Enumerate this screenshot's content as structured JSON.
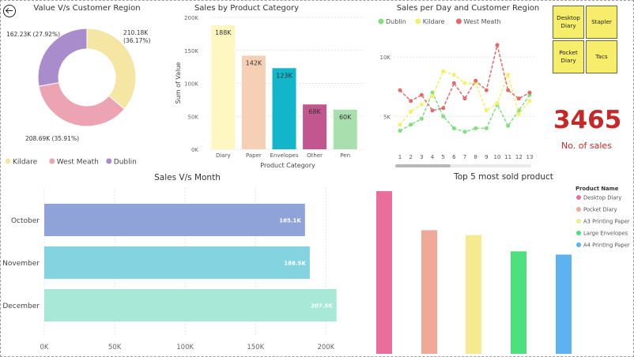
{
  "kpi": {
    "value": "3465",
    "label": "No. of sales"
  },
  "slicer": {
    "items": [
      "Desktop Diary",
      "Stapler",
      "Pocket Diary",
      "Tacs"
    ]
  },
  "colors": {
    "kpi": "#c62828",
    "slicer_bg": "#f6ee6a"
  },
  "icons": {
    "back": "back-arrow-icon"
  },
  "chart_data": [
    {
      "type": "pie",
      "title": "Value V/s Customer Region",
      "slices": [
        {
          "name": "Kildare",
          "value": 210.18,
          "label": "210.18K (36.17%)",
          "color": "#f5e6a3"
        },
        {
          "name": "West Meath",
          "value": 208.69,
          "label": "208.69K (35.91%)",
          "color": "#eca4b4"
        },
        {
          "name": "Dublin",
          "value": 162.23,
          "label": "162.23K (27.92%)",
          "color": "#a98ccb"
        }
      ],
      "legend": [
        "Kildare",
        "West Meath",
        "Dublin"
      ],
      "legend_position": "bottom-left"
    },
    {
      "type": "bar",
      "title": "Sales by Product Category",
      "categories": [
        "Diary",
        "Paper",
        "Envelopes",
        "Other",
        "Pen"
      ],
      "values": [
        188,
        142,
        123,
        68,
        60
      ],
      "data_labels": [
        "188K",
        "142K",
        "123K",
        "68K",
        "60K"
      ],
      "colors": [
        "#fff7c2",
        "#f5d0b4",
        "#12b5c9",
        "#c2568f",
        "#a9dfae"
      ],
      "xlabel": "Product Category",
      "ylabel": "Sum of Value",
      "yticks": [
        "0K",
        "50K",
        "100K",
        "150K",
        "200K"
      ],
      "ylim": [
        0,
        200
      ]
    },
    {
      "type": "line",
      "title": "Sales per Day and Customer Region",
      "x": [
        1,
        2,
        3,
        4,
        5,
        6,
        7,
        8,
        9,
        10,
        11,
        12,
        13
      ],
      "series": [
        {
          "name": "Dublin",
          "color": "#7ee07e",
          "values": [
            3.8,
            4.3,
            4.8,
            7.0,
            5.0,
            4.0,
            3.7,
            4.0,
            4.0,
            6.0,
            4.2,
            5.5,
            6.8
          ]
        },
        {
          "name": "Kildare",
          "color": "#f4f06a",
          "values": [
            4.3,
            5.4,
            6.0,
            6.7,
            8.8,
            8.5,
            7.8,
            7.8,
            5.5,
            6.1,
            8.5,
            5.2,
            6.3
          ]
        },
        {
          "name": "West Meath",
          "color": "#e46a6a",
          "values": [
            7.2,
            6.3,
            6.8,
            5.5,
            5.7,
            7.8,
            6.5,
            8.0,
            7.2,
            11.0,
            7.2,
            6.5,
            7.0
          ]
        }
      ],
      "yticks": [
        "5K",
        "10K"
      ],
      "ylim": [
        2.5,
        12
      ],
      "legend_position": "top-left"
    },
    {
      "type": "bar",
      "orientation": "horizontal",
      "title": "Sales V/s Month",
      "categories": [
        "October",
        "November",
        "December"
      ],
      "values": [
        185.1,
        188.5,
        207.5
      ],
      "data_labels": [
        "185.1K",
        "188.5K",
        "207.5K"
      ],
      "colors": [
        "#8fa3d9",
        "#84d3e0",
        "#a8e8d6"
      ],
      "xticks": [
        "0K",
        "50K",
        "100K",
        "150K",
        "200K"
      ],
      "xlim": [
        0,
        220
      ]
    },
    {
      "type": "bar",
      "title": "Top 5 most sold product",
      "categories": [
        "Desktop Diary",
        "Pocket Diary",
        "A3 Printing Paper",
        "Large Envelopes",
        "A4 Printing Paper"
      ],
      "values": [
        100,
        76,
        73,
        63,
        61
      ],
      "colors": [
        "#ea6e9c",
        "#f0a898",
        "#f6ea90",
        "#4ee07e",
        "#5db3ef"
      ],
      "legend_title": "Product Name",
      "legend_position": "right"
    }
  ]
}
